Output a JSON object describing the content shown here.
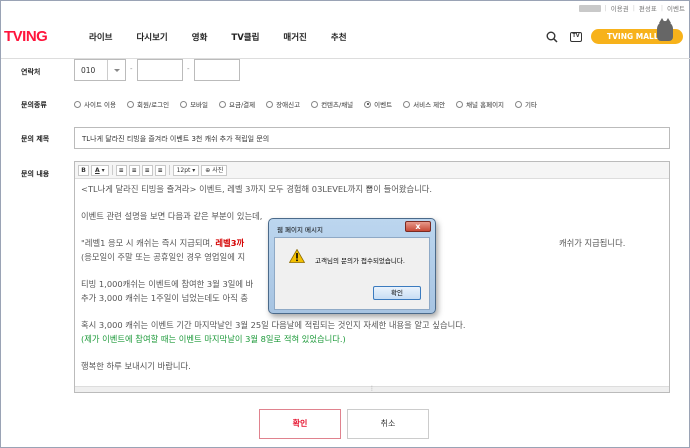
{
  "utility_bar": {
    "items": [
      "이용권",
      "편성표",
      "이벤트"
    ]
  },
  "header": {
    "logo": "TVING",
    "nav": [
      "라이브",
      "다시보기",
      "영화",
      "TV클립",
      "매거진",
      "추천"
    ],
    "tv_icon_label": "TV",
    "mall_button": "TVING MALL"
  },
  "form": {
    "contact_label": "연락처",
    "phone_prefix": "010",
    "phone_separator": "-",
    "type_label": "문의종류",
    "types": [
      {
        "label": "사이트 이용",
        "selected": false
      },
      {
        "label": "회원/로그인",
        "selected": false
      },
      {
        "label": "모바일",
        "selected": false
      },
      {
        "label": "요금/결제",
        "selected": false
      },
      {
        "label": "장애신고",
        "selected": false
      },
      {
        "label": "컨텐츠/채널",
        "selected": false
      },
      {
        "label": "이벤트",
        "selected": true
      },
      {
        "label": "서비스 제안",
        "selected": false
      },
      {
        "label": "채널 홈페이지",
        "selected": false
      },
      {
        "label": "기타",
        "selected": false
      }
    ],
    "title_label": "문의 제목",
    "title_value": "TL나게 달라진 티빙을 즐겨라 이벤트 3천 캐쉬 추가 적립일 문의",
    "content_label": "문의 내용",
    "toolbar": {
      "bold": "B",
      "color": "A",
      "font_size": "12pt",
      "photo": "사진"
    },
    "content_lines": {
      "l1": "<TL나게 달라진 티빙을 즐겨라> 이벤트, 레벨 3까지 모두 경험해 03LEVEL까지 뽑이 들어왔습니다.",
      "l2": "이벤트 관련 설명을 보면 다음과 같은 부분이 있는데,",
      "l3a": "\"레벨1 응모 시 캐쉬는 즉시 지급되며, ",
      "l3b": "레벨3까",
      "l3c": "캐쉬가 지급됩니다.",
      "l4": "(응모일이 주말 또는 공휴일인 경우 영업일에 지",
      "l5": "티빙 1,000캐쉬는 이벤트에 참여한 3월 3일에 바",
      "l6": "추가 3,000 캐쉬는 1주일이 넘었는데도 아직 충",
      "l7": "혹시 3,000 캐쉬는 이벤트 기간 마지막날인 3월 25일 다음날에 적립되는 것인지 자세한 내용을 알고 싶습니다.",
      "l8": "(제가 이벤트에 참여할 때는 이벤트 마지막날이 3월 8일로 적혀 있었습니다.)",
      "l9": "행복한 하루 보내시기 바랍니다."
    },
    "confirm_button": "확인",
    "cancel_button": "취소"
  },
  "dialog": {
    "title": "웹 페이지 메시지",
    "message": "고객님의 문의가 접수되었습니다.",
    "ok_button": "확인",
    "close_glyph": "x"
  }
}
